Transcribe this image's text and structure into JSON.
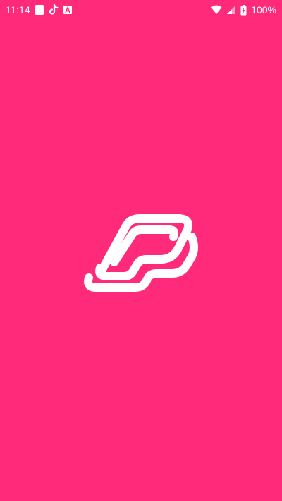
{
  "status_bar": {
    "time": "11:14",
    "battery_percent": "100%",
    "notification_icons": [
      "app-notification-icon",
      "tiktok-icon",
      "a-badge-icon"
    ],
    "system_icons": [
      "wifi-icon",
      "cellular-signal-icon",
      "battery-charging-icon"
    ]
  },
  "splash": {
    "background_color": "#ff2a7a",
    "logo_color": "#ffffff",
    "logo_icon": "brand-logo-icon"
  }
}
